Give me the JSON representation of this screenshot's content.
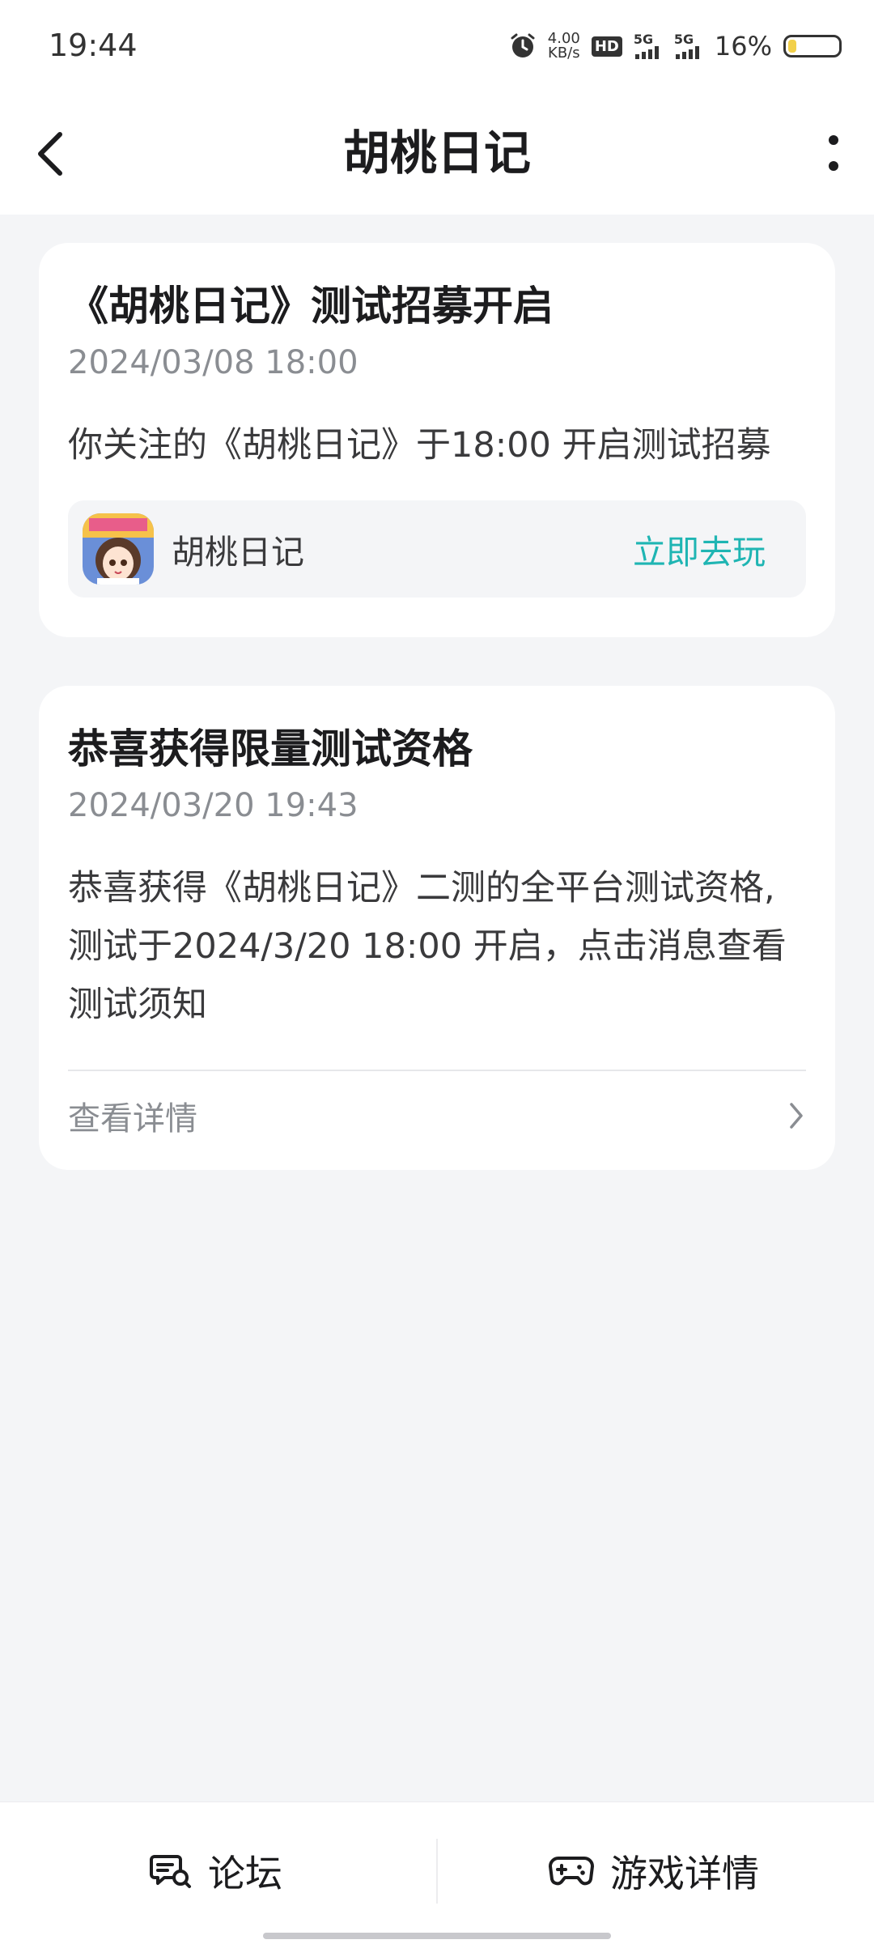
{
  "status_bar": {
    "time": "19:44",
    "net_speed_value": "4.00",
    "net_speed_unit": "KB/s",
    "hd_label": "HD",
    "sim1_label": "5G",
    "sim2_label": "5G",
    "battery_percent": "16%",
    "battery_level": 0.16,
    "battery_color": "#f2d04a"
  },
  "header": {
    "title": "胡桃日记"
  },
  "cards": [
    {
      "title": "《胡桃日记》测试招募开启",
      "time": "2024/03/08 18:00",
      "body": "你关注的《胡桃日记》于18:00 开启测试招募",
      "game": {
        "name": "胡桃日记",
        "icon": "game-app-icon",
        "action_label": "立即去玩"
      }
    },
    {
      "title": "恭喜获得限量测试资格",
      "time": "2024/03/20 19:43",
      "body": "恭喜获得《胡桃日记》二测的全平台测试资格,测试于2024/3/20 18:00 开启，点击消息查看测试须知",
      "detail_label": "查看详情"
    }
  ],
  "bottom_bar": {
    "forum_label": "论坛",
    "forum_icon": "forum-chat-icon",
    "game_label": "游戏详情",
    "game_icon": "gamepad-icon"
  },
  "colors": {
    "accent": "#1fb5b3",
    "background": "#f4f5f7",
    "card": "#ffffff"
  }
}
